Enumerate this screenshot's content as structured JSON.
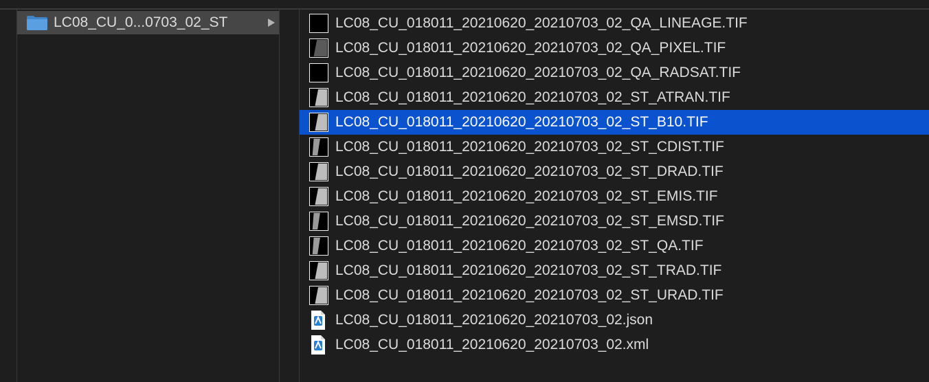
{
  "parent_folder": {
    "label": "LC08_CU_0...0703_02_ST",
    "icon": "folder-icon",
    "accent": "#5aa0e0"
  },
  "files": [
    {
      "name": "LC08_CU_018011_20210620_20210703_02_QA_LINEAGE.TIF",
      "icon": "raster-thumbnail-black-icon",
      "selected": false
    },
    {
      "name": "LC08_CU_018011_20210620_20210703_02_QA_PIXEL.TIF",
      "icon": "raster-thumbnail-gray-icon",
      "selected": false
    },
    {
      "name": "LC08_CU_018011_20210620_20210703_02_QA_RADSAT.TIF",
      "icon": "raster-thumbnail-black-icon",
      "selected": false
    },
    {
      "name": "LC08_CU_018011_20210620_20210703_02_ST_ATRAN.TIF",
      "icon": "raster-thumbnail-light-icon",
      "selected": false
    },
    {
      "name": "LC08_CU_018011_20210620_20210703_02_ST_B10.TIF",
      "icon": "raster-thumbnail-light-icon",
      "selected": true
    },
    {
      "name": "LC08_CU_018011_20210620_20210703_02_ST_CDIST.TIF",
      "icon": "raster-thumbnail-dark-icon",
      "selected": false
    },
    {
      "name": "LC08_CU_018011_20210620_20210703_02_ST_DRAD.TIF",
      "icon": "raster-thumbnail-light-icon",
      "selected": false
    },
    {
      "name": "LC08_CU_018011_20210620_20210703_02_ST_EMIS.TIF",
      "icon": "raster-thumbnail-light-icon",
      "selected": false
    },
    {
      "name": "LC08_CU_018011_20210620_20210703_02_ST_EMSD.TIF",
      "icon": "raster-thumbnail-dark-icon",
      "selected": false
    },
    {
      "name": "LC08_CU_018011_20210620_20210703_02_ST_QA.TIF",
      "icon": "raster-thumbnail-dark-icon",
      "selected": false
    },
    {
      "name": "LC08_CU_018011_20210620_20210703_02_ST_TRAD.TIF",
      "icon": "raster-thumbnail-light-icon",
      "selected": false
    },
    {
      "name": "LC08_CU_018011_20210620_20210703_02_ST_URAD.TIF",
      "icon": "raster-thumbnail-light-icon",
      "selected": false
    },
    {
      "name": "LC08_CU_018011_20210620_20210703_02.json",
      "icon": "document-icon",
      "selected": false
    },
    {
      "name": "LC08_CU_018011_20210620_20210703_02.xml",
      "icon": "document-icon",
      "selected": false
    }
  ],
  "colors": {
    "background": "#1e1e1e",
    "selection": "#0b52cf",
    "parent_highlight": "#464646",
    "text": "#dcdcdc"
  }
}
